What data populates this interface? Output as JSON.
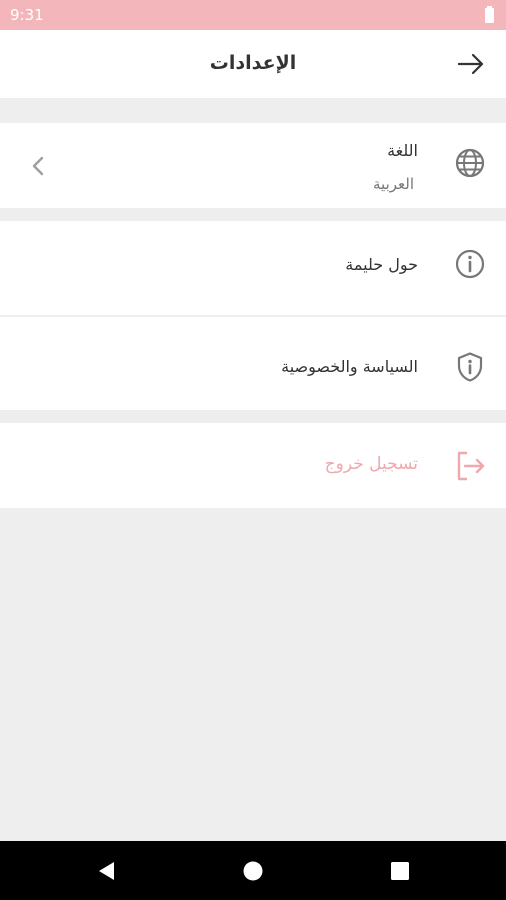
{
  "status_bar": {
    "time": "9:31"
  },
  "header": {
    "title": "الإعدادات",
    "back_icon": "arrow-right-icon"
  },
  "settings": {
    "language": {
      "title": "اللغة",
      "value": "العربية",
      "icon": "globe-icon"
    },
    "about": {
      "title": "حول حليمة",
      "icon": "info-icon"
    },
    "privacy": {
      "title": "السياسة والخصوصية",
      "icon": "shield-info-icon"
    },
    "logout": {
      "title": "تسجيل خروج",
      "icon": "logout-icon"
    }
  },
  "colors": {
    "status_bar": "#f2b6bb",
    "accent": "#f0a8ae",
    "background": "#eeeeee",
    "text": "#333333",
    "icon": "#777777"
  },
  "nav": {
    "back": "back-icon",
    "home": "home-icon",
    "recents": "recents-icon"
  }
}
